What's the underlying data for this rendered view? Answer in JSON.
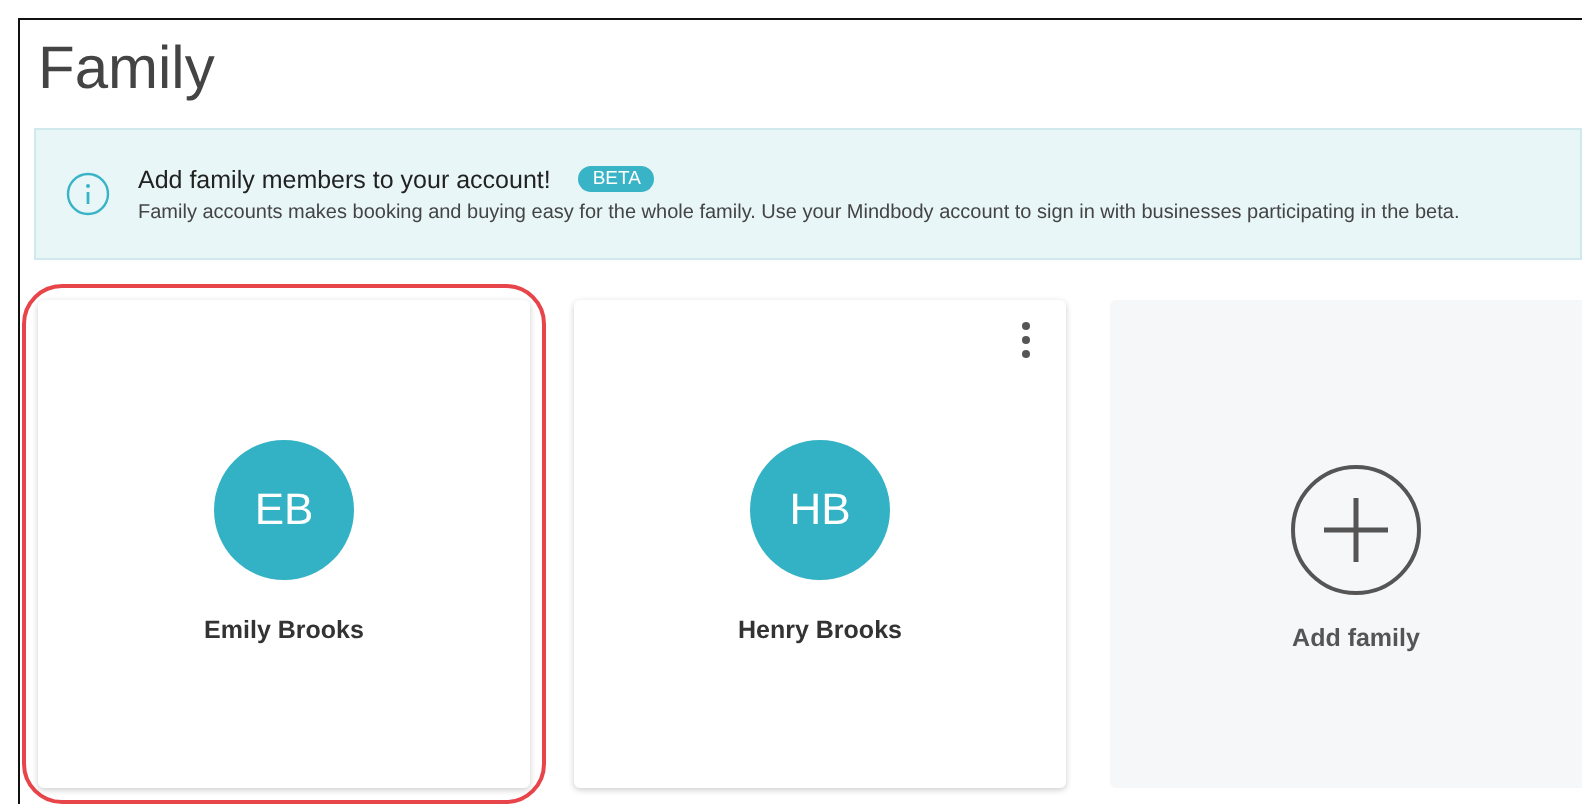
{
  "page": {
    "title": "Family"
  },
  "banner": {
    "heading": "Add family members to your account!",
    "badge": "BETA",
    "text": "Family accounts makes booking and buying easy for the whole family. Use your Mindbody account to sign in with businesses participating in the beta."
  },
  "cards": [
    {
      "kind": "member",
      "initials": "EB",
      "name": "Emily Brooks",
      "selected": true,
      "menu": false
    },
    {
      "kind": "member",
      "initials": "HB",
      "name": "Henry Brooks",
      "selected": false,
      "menu": true
    },
    {
      "kind": "add",
      "label": "Add family",
      "selected": false
    }
  ]
}
